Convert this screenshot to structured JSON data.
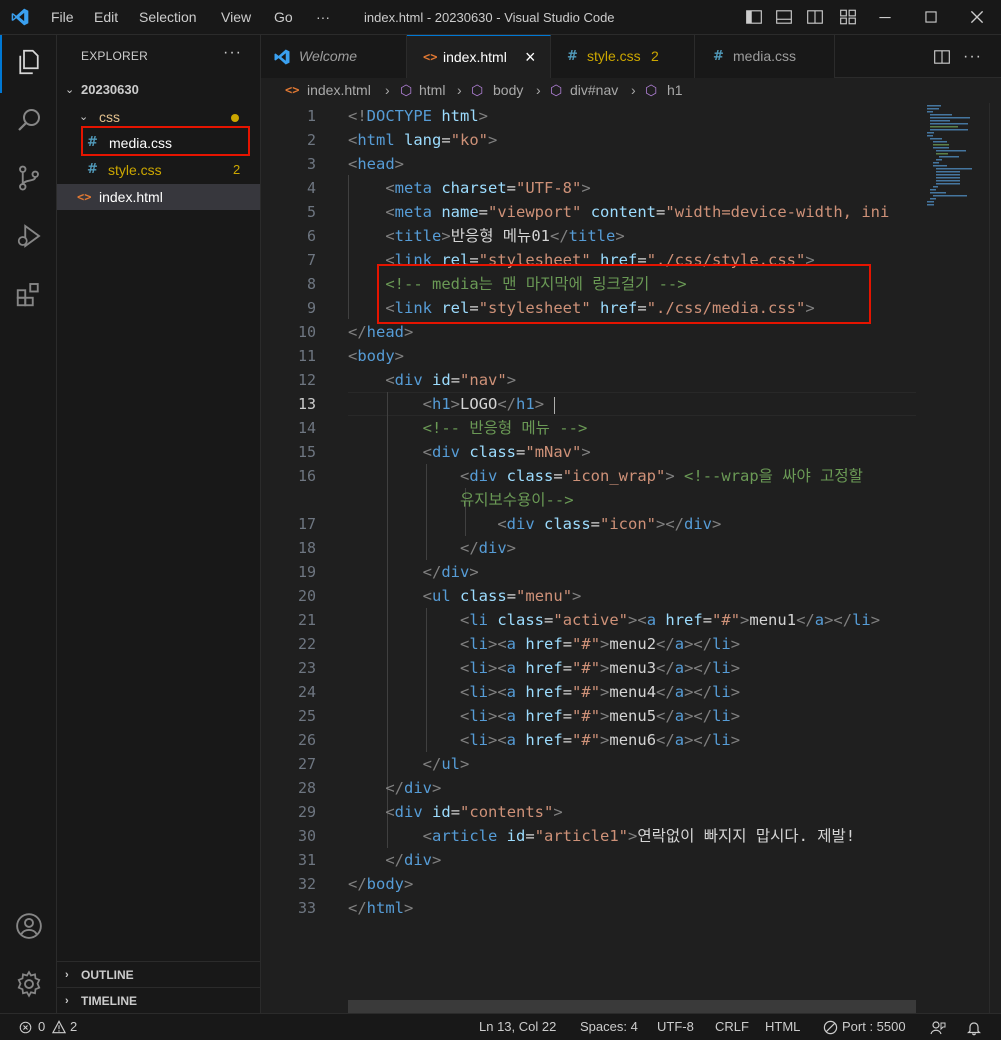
{
  "titlebar": {
    "menus": [
      "File",
      "Edit",
      "Selection",
      "View",
      "Go",
      "···"
    ],
    "title": "index.html - 20230630 - Visual Studio Code"
  },
  "explorer": {
    "title": "EXPLORER",
    "more": "···",
    "root": "20230630",
    "folder": "css",
    "files": [
      {
        "name": "media.css",
        "icon": "#"
      },
      {
        "name": "style.css",
        "icon": "#",
        "badge": "2"
      },
      {
        "name": "index.html",
        "icon": "<>"
      }
    ],
    "outline": "OUTLINE",
    "timeline": "TIMELINE"
  },
  "tabs": [
    {
      "label": "Welcome",
      "icon": "vscode-icon"
    },
    {
      "label": "index.html",
      "icon": "<>",
      "close": "×"
    },
    {
      "label": "style.css",
      "icon": "#",
      "badge": "2"
    },
    {
      "label": "media.css",
      "icon": "#"
    }
  ],
  "breadcrumb": [
    "index.html",
    "html",
    "body",
    "div#nav",
    "h1"
  ],
  "editor": {
    "line_numbers": [
      "1",
      "2",
      "3",
      "4",
      "5",
      "6",
      "7",
      "8",
      "9",
      "10",
      "11",
      "12",
      "13",
      "14",
      "15",
      "16",
      "",
      "17",
      "18",
      "19",
      "20",
      "21",
      "22",
      "23",
      "24",
      "25",
      "26",
      "27",
      "28",
      "29",
      "30",
      "31",
      "32",
      "33"
    ],
    "current_line": "13",
    "lines": [
      [
        [
          "p",
          "<!"
        ],
        [
          "t",
          "DOCTYPE"
        ],
        [
          "x",
          " "
        ],
        [
          "a",
          "html"
        ],
        [
          "p",
          ">"
        ]
      ],
      [
        [
          "p",
          "<"
        ],
        [
          "t",
          "html"
        ],
        [
          "x",
          " "
        ],
        [
          "a",
          "lang"
        ],
        [
          "x",
          "="
        ],
        [
          "s",
          "\"ko\""
        ],
        [
          "p",
          ">"
        ]
      ],
      [
        [
          "p",
          "<"
        ],
        [
          "t",
          "head"
        ],
        [
          "p",
          ">"
        ]
      ],
      [
        [
          "x",
          "    "
        ],
        [
          "p",
          "<"
        ],
        [
          "t",
          "meta"
        ],
        [
          "x",
          " "
        ],
        [
          "a",
          "charset"
        ],
        [
          "x",
          "="
        ],
        [
          "s",
          "\"UTF-8\""
        ],
        [
          "p",
          ">"
        ]
      ],
      [
        [
          "x",
          "    "
        ],
        [
          "p",
          "<"
        ],
        [
          "t",
          "meta"
        ],
        [
          "x",
          " "
        ],
        [
          "a",
          "name"
        ],
        [
          "x",
          "="
        ],
        [
          "s",
          "\"viewport\""
        ],
        [
          "x",
          " "
        ],
        [
          "a",
          "content"
        ],
        [
          "x",
          "="
        ],
        [
          "s",
          "\"width=device-width, ini"
        ]
      ],
      [
        [
          "x",
          "    "
        ],
        [
          "p",
          "<"
        ],
        [
          "t",
          "title"
        ],
        [
          "p",
          ">"
        ],
        [
          "x",
          "반응형 메뉴01"
        ],
        [
          "p",
          "</"
        ],
        [
          "t",
          "title"
        ],
        [
          "p",
          ">"
        ]
      ],
      [
        [
          "x",
          "    "
        ],
        [
          "p",
          "<"
        ],
        [
          "t",
          "link"
        ],
        [
          "x",
          " "
        ],
        [
          "a",
          "rel"
        ],
        [
          "x",
          "="
        ],
        [
          "s",
          "\"stylesheet\""
        ],
        [
          "x",
          " "
        ],
        [
          "a",
          "href"
        ],
        [
          "x",
          "="
        ],
        [
          "s",
          "\"./css/style.css\""
        ],
        [
          "p",
          ">"
        ]
      ],
      [
        [
          "x",
          "    "
        ],
        [
          "c",
          "<!-- media는 맨 마지막에 링크걸기 -->"
        ]
      ],
      [
        [
          "x",
          "    "
        ],
        [
          "p",
          "<"
        ],
        [
          "t",
          "link"
        ],
        [
          "x",
          " "
        ],
        [
          "a",
          "rel"
        ],
        [
          "x",
          "="
        ],
        [
          "s",
          "\"stylesheet\""
        ],
        [
          "x",
          " "
        ],
        [
          "a",
          "href"
        ],
        [
          "x",
          "="
        ],
        [
          "s",
          "\"./css/media.css\""
        ],
        [
          "p",
          ">"
        ]
      ],
      [
        [
          "p",
          "</"
        ],
        [
          "t",
          "head"
        ],
        [
          "p",
          ">"
        ]
      ],
      [
        [
          "p",
          "<"
        ],
        [
          "t",
          "body"
        ],
        [
          "p",
          ">"
        ]
      ],
      [
        [
          "x",
          "    "
        ],
        [
          "p",
          "<"
        ],
        [
          "t",
          "div"
        ],
        [
          "x",
          " "
        ],
        [
          "a",
          "id"
        ],
        [
          "x",
          "="
        ],
        [
          "s",
          "\"nav\""
        ],
        [
          "p",
          ">"
        ]
      ],
      [
        [
          "x",
          "        "
        ],
        [
          "p",
          "<"
        ],
        [
          "t",
          "h1"
        ],
        [
          "p",
          ">"
        ],
        [
          "x",
          "LOGO"
        ],
        [
          "p",
          "</"
        ],
        [
          "t",
          "h1"
        ],
        [
          "p",
          ">"
        ]
      ],
      [
        [
          "x",
          "        "
        ],
        [
          "c",
          "<!-- 반응형 메뉴 -->"
        ]
      ],
      [
        [
          "x",
          "        "
        ],
        [
          "p",
          "<"
        ],
        [
          "t",
          "div"
        ],
        [
          "x",
          " "
        ],
        [
          "a",
          "class"
        ],
        [
          "x",
          "="
        ],
        [
          "s",
          "\"mNav\""
        ],
        [
          "p",
          ">"
        ]
      ],
      [
        [
          "x",
          "            "
        ],
        [
          "p",
          "<"
        ],
        [
          "t",
          "div"
        ],
        [
          "x",
          " "
        ],
        [
          "a",
          "class"
        ],
        [
          "x",
          "="
        ],
        [
          "s",
          "\"icon_wrap\""
        ],
        [
          "p",
          ">"
        ],
        [
          "x",
          " "
        ],
        [
          "c",
          "<!--wrap을 싸야 고정할"
        ]
      ],
      [
        [
          "x",
          "            "
        ],
        [
          "c",
          "유지보수용이-->"
        ]
      ],
      [
        [
          "x",
          "                "
        ],
        [
          "p",
          "<"
        ],
        [
          "t",
          "div"
        ],
        [
          "x",
          " "
        ],
        [
          "a",
          "class"
        ],
        [
          "x",
          "="
        ],
        [
          "s",
          "\"icon\""
        ],
        [
          "p",
          "></"
        ],
        [
          "t",
          "div"
        ],
        [
          "p",
          ">"
        ]
      ],
      [
        [
          "x",
          "            "
        ],
        [
          "p",
          "</"
        ],
        [
          "t",
          "div"
        ],
        [
          "p",
          ">"
        ]
      ],
      [
        [
          "x",
          "        "
        ],
        [
          "p",
          "</"
        ],
        [
          "t",
          "div"
        ],
        [
          "p",
          ">"
        ]
      ],
      [
        [
          "x",
          "        "
        ],
        [
          "p",
          "<"
        ],
        [
          "t",
          "ul"
        ],
        [
          "x",
          " "
        ],
        [
          "a",
          "class"
        ],
        [
          "x",
          "="
        ],
        [
          "s",
          "\"menu\""
        ],
        [
          "p",
          ">"
        ]
      ],
      [
        [
          "x",
          "            "
        ],
        [
          "p",
          "<"
        ],
        [
          "t",
          "li"
        ],
        [
          "x",
          " "
        ],
        [
          "a",
          "class"
        ],
        [
          "x",
          "="
        ],
        [
          "s",
          "\"active\""
        ],
        [
          "p",
          "><"
        ],
        [
          "t",
          "a"
        ],
        [
          "x",
          " "
        ],
        [
          "a",
          "href"
        ],
        [
          "x",
          "="
        ],
        [
          "s",
          "\"#\""
        ],
        [
          "p",
          ">"
        ],
        [
          "x",
          "menu1"
        ],
        [
          "p",
          "</"
        ],
        [
          "t",
          "a"
        ],
        [
          "p",
          "></"
        ],
        [
          "t",
          "li"
        ],
        [
          "p",
          ">"
        ]
      ],
      [
        [
          "x",
          "            "
        ],
        [
          "p",
          "<"
        ],
        [
          "t",
          "li"
        ],
        [
          "p",
          "><"
        ],
        [
          "t",
          "a"
        ],
        [
          "x",
          " "
        ],
        [
          "a",
          "href"
        ],
        [
          "x",
          "="
        ],
        [
          "s",
          "\"#\""
        ],
        [
          "p",
          ">"
        ],
        [
          "x",
          "menu2"
        ],
        [
          "p",
          "</"
        ],
        [
          "t",
          "a"
        ],
        [
          "p",
          "></"
        ],
        [
          "t",
          "li"
        ],
        [
          "p",
          ">"
        ]
      ],
      [
        [
          "x",
          "            "
        ],
        [
          "p",
          "<"
        ],
        [
          "t",
          "li"
        ],
        [
          "p",
          "><"
        ],
        [
          "t",
          "a"
        ],
        [
          "x",
          " "
        ],
        [
          "a",
          "href"
        ],
        [
          "x",
          "="
        ],
        [
          "s",
          "\"#\""
        ],
        [
          "p",
          ">"
        ],
        [
          "x",
          "menu3"
        ],
        [
          "p",
          "</"
        ],
        [
          "t",
          "a"
        ],
        [
          "p",
          "></"
        ],
        [
          "t",
          "li"
        ],
        [
          "p",
          ">"
        ]
      ],
      [
        [
          "x",
          "            "
        ],
        [
          "p",
          "<"
        ],
        [
          "t",
          "li"
        ],
        [
          "p",
          "><"
        ],
        [
          "t",
          "a"
        ],
        [
          "x",
          " "
        ],
        [
          "a",
          "href"
        ],
        [
          "x",
          "="
        ],
        [
          "s",
          "\"#\""
        ],
        [
          "p",
          ">"
        ],
        [
          "x",
          "menu4"
        ],
        [
          "p",
          "</"
        ],
        [
          "t",
          "a"
        ],
        [
          "p",
          "></"
        ],
        [
          "t",
          "li"
        ],
        [
          "p",
          ">"
        ]
      ],
      [
        [
          "x",
          "            "
        ],
        [
          "p",
          "<"
        ],
        [
          "t",
          "li"
        ],
        [
          "p",
          "><"
        ],
        [
          "t",
          "a"
        ],
        [
          "x",
          " "
        ],
        [
          "a",
          "href"
        ],
        [
          "x",
          "="
        ],
        [
          "s",
          "\"#\""
        ],
        [
          "p",
          ">"
        ],
        [
          "x",
          "menu5"
        ],
        [
          "p",
          "</"
        ],
        [
          "t",
          "a"
        ],
        [
          "p",
          "></"
        ],
        [
          "t",
          "li"
        ],
        [
          "p",
          ">"
        ]
      ],
      [
        [
          "x",
          "            "
        ],
        [
          "p",
          "<"
        ],
        [
          "t",
          "li"
        ],
        [
          "p",
          "><"
        ],
        [
          "t",
          "a"
        ],
        [
          "x",
          " "
        ],
        [
          "a",
          "href"
        ],
        [
          "x",
          "="
        ],
        [
          "s",
          "\"#\""
        ],
        [
          "p",
          ">"
        ],
        [
          "x",
          "menu6"
        ],
        [
          "p",
          "</"
        ],
        [
          "t",
          "a"
        ],
        [
          "p",
          "></"
        ],
        [
          "t",
          "li"
        ],
        [
          "p",
          ">"
        ]
      ],
      [
        [
          "x",
          "        "
        ],
        [
          "p",
          "</"
        ],
        [
          "t",
          "ul"
        ],
        [
          "p",
          ">"
        ]
      ],
      [
        [
          "x",
          "    "
        ],
        [
          "p",
          "</"
        ],
        [
          "t",
          "div"
        ],
        [
          "p",
          ">"
        ]
      ],
      [
        [
          "x",
          "    "
        ],
        [
          "p",
          "<"
        ],
        [
          "t",
          "div"
        ],
        [
          "x",
          " "
        ],
        [
          "a",
          "id"
        ],
        [
          "x",
          "="
        ],
        [
          "s",
          "\"contents\""
        ],
        [
          "p",
          ">"
        ]
      ],
      [
        [
          "x",
          "        "
        ],
        [
          "p",
          "<"
        ],
        [
          "t",
          "article"
        ],
        [
          "x",
          " "
        ],
        [
          "a",
          "id"
        ],
        [
          "x",
          "="
        ],
        [
          "s",
          "\"article1\""
        ],
        [
          "p",
          ">"
        ],
        [
          "x",
          "연락없이 빠지지 맙시다. 제발!"
        ]
      ],
      [
        [
          "x",
          "    "
        ],
        [
          "p",
          "</"
        ],
        [
          "t",
          "div"
        ],
        [
          "p",
          ">"
        ]
      ],
      [
        [
          "p",
          "</"
        ],
        [
          "t",
          "body"
        ],
        [
          "p",
          ">"
        ]
      ],
      [
        [
          "p",
          "</"
        ],
        [
          "t",
          "html"
        ],
        [
          "p",
          ">"
        ]
      ]
    ]
  },
  "statusbar": {
    "errors": "0",
    "warnings": "2",
    "position": "Ln 13, Col 22",
    "spaces": "Spaces: 4",
    "encoding": "UTF-8",
    "eol": "CRLF",
    "language": "HTML",
    "port": "Port : 5500"
  },
  "colors": {
    "accent": "#0078d4",
    "highlight_box": "#e51400",
    "tag": "#569cd6",
    "attribute": "#9cdcfe",
    "string": "#ce9178",
    "comment": "#6a9955",
    "css_icon": "#519aba",
    "html_icon": "#e37933",
    "modified": "#cca700"
  }
}
